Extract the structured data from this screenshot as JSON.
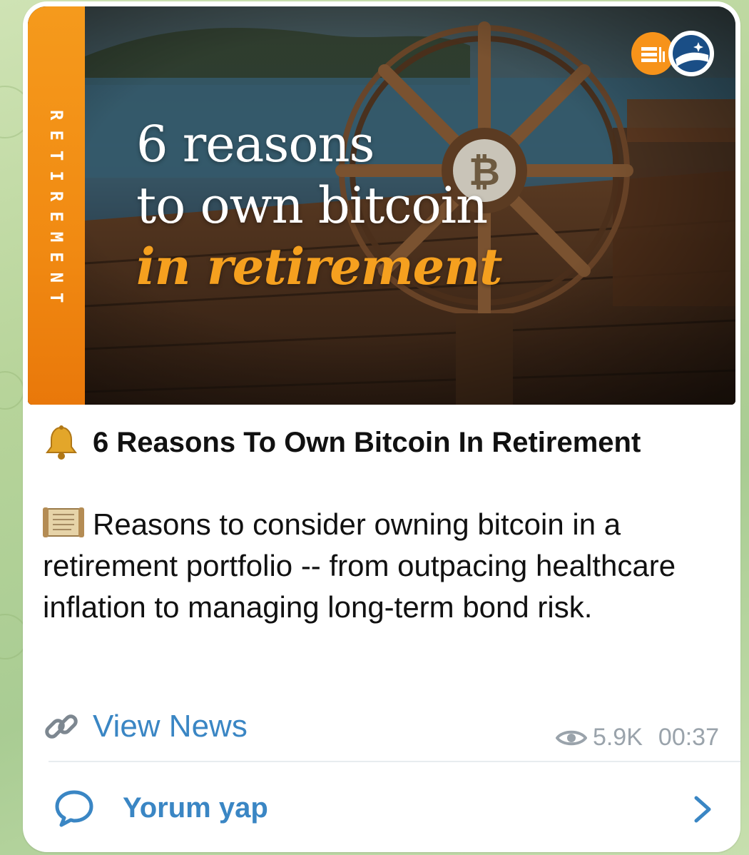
{
  "post": {
    "image": {
      "side_label": "RETIREMENT",
      "headline_line1": "6 reasons",
      "headline_line2": "to own bitcoin",
      "headline_accent": "in retirement"
    },
    "title_emoji": "bell-icon",
    "title": "6 Reasons To Own Bitcoin In Retirement",
    "description_emoji": "scroll-icon",
    "description": "Reasons to consider owning bitcoin in a retirement portfolio -- from outpacing healthcare inflation to managing long-term bond risk.",
    "link_icon": "link-icon",
    "link_label": "View News",
    "views": "5.9K",
    "time": "00:37"
  },
  "comments": {
    "icon": "comment-bubble-icon",
    "label": "Yorum yap",
    "chevron": "chevron-right-icon"
  },
  "colors": {
    "accent_orange": "#f5a01f",
    "link_blue": "#3a86c4",
    "meta_gray": "#9aa3ab",
    "chat_background": "#b7d49a"
  }
}
